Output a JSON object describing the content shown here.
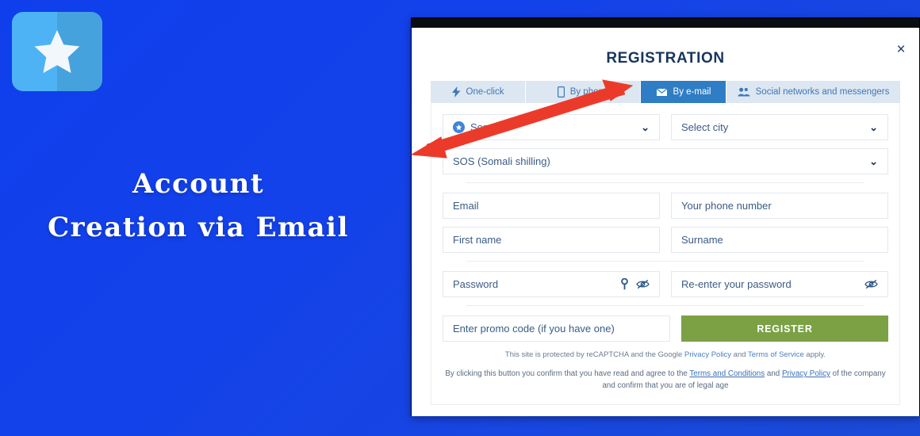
{
  "promo": {
    "heading_line1": "Account",
    "heading_line2": "Creation via Email",
    "logo_name": "somali-flag-logo"
  },
  "modal": {
    "title": "REGISTRATION",
    "close_label": "×"
  },
  "tabs": [
    {
      "label": "One-click",
      "icon": "lightning-icon",
      "active": false
    },
    {
      "label": "By phone",
      "icon": "phone-icon",
      "active": false
    },
    {
      "label": "By e-mail",
      "icon": "envelope-icon",
      "active": true
    },
    {
      "label": "Social networks and messengers",
      "icon": "people-icon",
      "active": false
    }
  ],
  "form": {
    "country": "Somali",
    "city_placeholder": "Select city",
    "currency": "SOS (Somali shilling)",
    "email_placeholder": "Email",
    "phone_placeholder": "Your phone number",
    "first_name_placeholder": "First name",
    "surname_placeholder": "Surname",
    "password_placeholder": "Password",
    "repeat_password_placeholder": "Re-enter your password",
    "promo_placeholder": "Enter promo code (if you have one)",
    "register_label": "REGISTER"
  },
  "legal": {
    "recaptcha_pre": "This site is protected by reCAPTCHA and the Google ",
    "recaptcha_link1": "Privacy Policy",
    "recaptcha_mid": " and ",
    "recaptcha_link2": "Terms of Service",
    "recaptcha_post": " apply.",
    "terms_pre": "By clicking this button you confirm that you have read and agree to the ",
    "terms_link1": "Terms and Conditions",
    "terms_mid": " and ",
    "terms_link2": "Privacy Policy",
    "terms_post": " of the company and confirm that you are of legal age"
  },
  "annotation": {
    "type": "double-headed-arrow",
    "color": "#ec3a2a"
  },
  "colors": {
    "page_background": "#1240e8",
    "active_tab": "#2f7dc4",
    "tab_bar": "#dce7f1",
    "register_button": "#7ba144",
    "title_text": "#17365d",
    "arrow": "#ec3a2a"
  }
}
